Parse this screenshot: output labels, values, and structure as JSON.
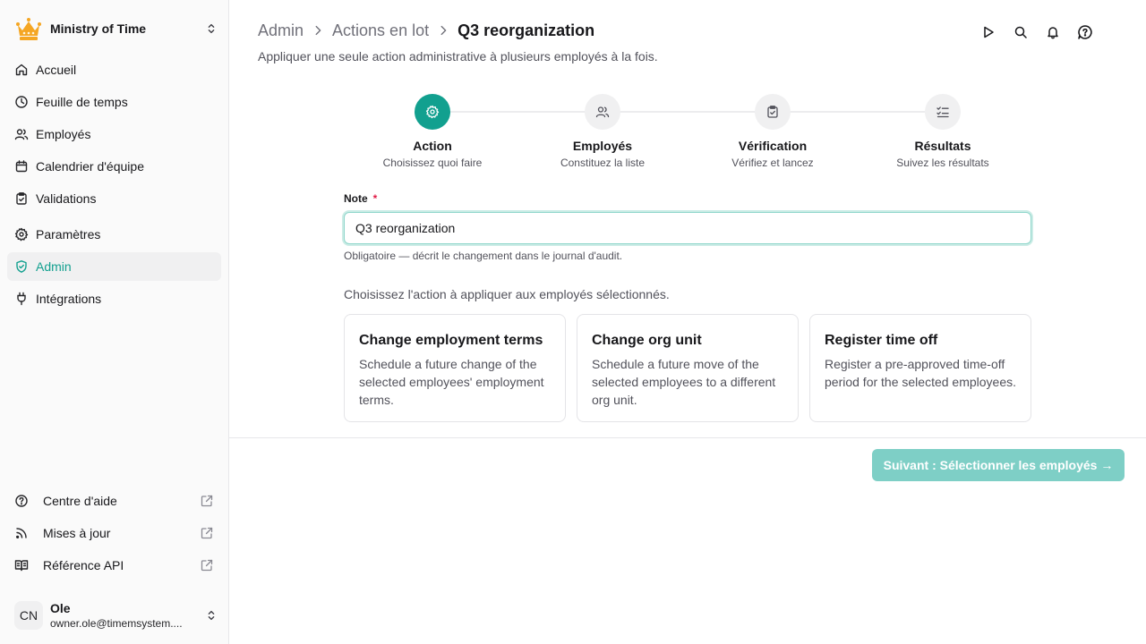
{
  "sidebar": {
    "org_name": "Ministry of Time",
    "nav": [
      {
        "label": "Accueil",
        "icon": "home-icon"
      },
      {
        "label": "Feuille de temps",
        "icon": "clock-icon"
      },
      {
        "label": "Employés",
        "icon": "users-icon"
      },
      {
        "label": "Calendrier d'équipe",
        "icon": "calendar-icon"
      },
      {
        "label": "Validations",
        "icon": "clipboard-check-icon"
      },
      {
        "label": "Paramètres",
        "icon": "gear-icon"
      },
      {
        "label": "Admin",
        "icon": "shield-check-icon",
        "active": true
      },
      {
        "label": "Intégrations",
        "icon": "plug-icon"
      }
    ],
    "external": [
      {
        "label": "Centre d'aide",
        "icon": "help-circle-icon"
      },
      {
        "label": "Mises à jour",
        "icon": "rss-icon"
      },
      {
        "label": "Référence API",
        "icon": "book-icon"
      }
    ],
    "user": {
      "initials": "CN",
      "name": "Ole",
      "email": "owner.ole@timemsystem...."
    }
  },
  "header": {
    "breadcrumbs": [
      "Admin",
      "Actions en lot"
    ],
    "current": "Q3 reorganization",
    "subtitle": "Appliquer une seule action administrative à plusieurs employés à la fois."
  },
  "stepper": [
    {
      "title": "Action",
      "subtitle": "Choisissez quoi faire",
      "icon": "gear-icon",
      "active": true
    },
    {
      "title": "Employés",
      "subtitle": "Constituez la liste",
      "icon": "users-icon"
    },
    {
      "title": "Vérification",
      "subtitle": "Vérifiez et lancez",
      "icon": "clipboard-check-icon"
    },
    {
      "title": "Résultats",
      "subtitle": "Suivez les résultats",
      "icon": "list-checks-icon"
    }
  ],
  "form": {
    "note_label": "Note",
    "required_mark": "*",
    "note_value": "Q3 reorganization",
    "note_help": "Obligatoire — décrit le changement dans le journal d'audit.",
    "choose_text": "Choisissez l'action à appliquer aux employés sélectionnés."
  },
  "actions": [
    {
      "title": "Change employment terms",
      "description": "Schedule a future change of the selected employees' employment terms."
    },
    {
      "title": "Change org unit",
      "description": "Schedule a future move of the selected employees to a different org unit."
    },
    {
      "title": "Register time off",
      "description": "Register a pre-approved time-off period for the selected employees."
    }
  ],
  "footer": {
    "next_label": "Suivant : Sélectionner les employés →"
  },
  "colors": {
    "accent": "#12a08f",
    "accent_disabled": "#7ecfc6",
    "crown": "#f5a623"
  }
}
